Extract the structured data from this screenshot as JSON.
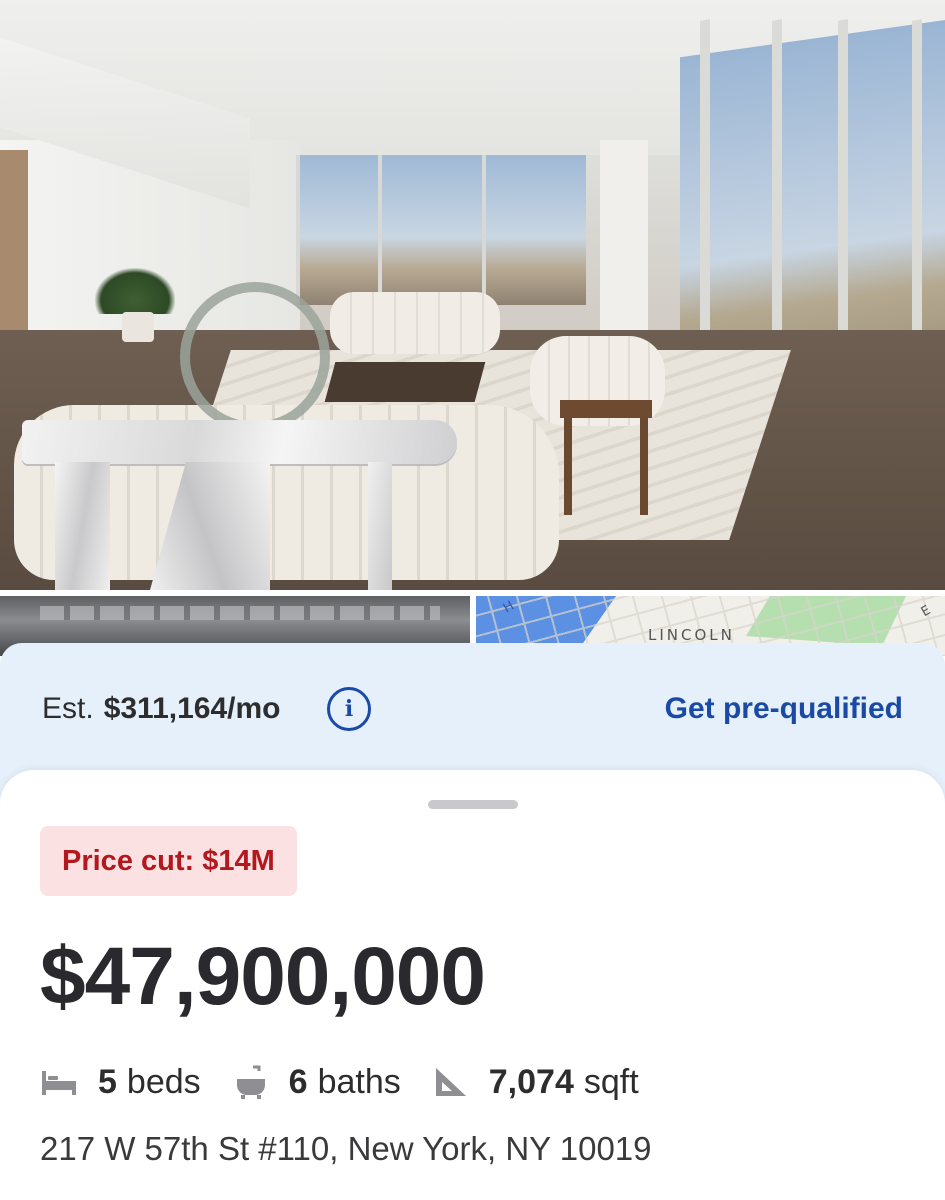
{
  "mortgage": {
    "est_label": "Est.",
    "est_amount": "$311,164/mo",
    "prequal_label": "Get pre-qualified"
  },
  "map_thumb": {
    "label": "LINCOLN",
    "letter_left": "H",
    "letter_right": "E"
  },
  "listing": {
    "price_cut_badge": "Price cut: $14M",
    "price": "$47,900,000",
    "beds_num": "5",
    "beds_label": "beds",
    "baths_num": "6",
    "baths_label": "baths",
    "sqft_num": "7,074",
    "sqft_label": "sqft",
    "address": "217 W 57th St #110, New York, NY 10019"
  },
  "colors": {
    "link_blue": "#1b4aa5",
    "badge_bg": "#fbe1e1",
    "badge_text": "#b3181e",
    "mortgage_bg": "#e5f0fb"
  },
  "icons": {
    "info": "info-icon",
    "beds": "bed-icon",
    "baths": "bathtub-icon",
    "sqft": "ruler-triangle-icon"
  }
}
